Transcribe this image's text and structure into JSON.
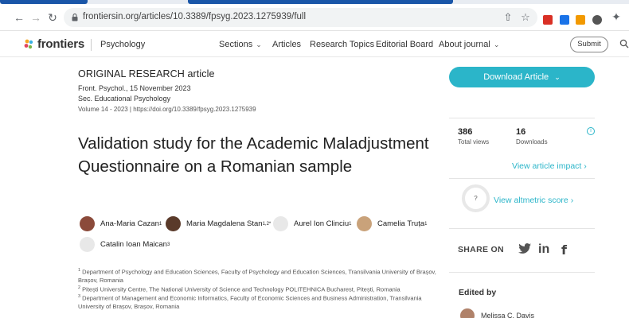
{
  "browser": {
    "url": "frontiersin.org/articles/10.3389/fpsyg.2023.1275939/full",
    "nav_icons": [
      "back-arrow-icon",
      "forward-arrow-icon",
      "reload-icon"
    ],
    "extension_colors": [
      "#d93025",
      "#1a73e8",
      "#f29900",
      "#555555"
    ]
  },
  "site": {
    "logo": "frontiers",
    "journal": "Psychology",
    "nav": [
      {
        "label": "Sections",
        "caret": true
      },
      {
        "label": "Articles",
        "caret": false
      },
      {
        "label": "Research Topics",
        "caret": false
      },
      {
        "label": "Editorial Board",
        "caret": false
      },
      {
        "label": "About journal",
        "caret": true
      }
    ],
    "submit": "Submit"
  },
  "article": {
    "type": "ORIGINAL RESEARCH article",
    "journal_date": "Front. Psychol., 15 November 2023",
    "section": "Sec. Educational Psychology",
    "volume_doi": "Volume 14 - 2023 | https://doi.org/10.3389/fpsyg.2023.1275939",
    "title": "Validation study for the Academic Maladjustment Questionnaire on a Romanian sample",
    "authors": [
      {
        "name": "Ana-Maria Cazan",
        "sup": "1"
      },
      {
        "name": "Maria Magdalena Stan",
        "sup": "1,2*"
      },
      {
        "name": "Aurel Ion Clinciu",
        "sup": "1"
      },
      {
        "name": "Camelia Truța",
        "sup": "1"
      },
      {
        "name": "Catalin Ioan Maican",
        "sup": "3"
      }
    ],
    "affiliations": [
      {
        "sup": "1",
        "text": " Department of Psychology and Education Sciences, Faculty of Psychology and Education Sciences, Transilvania University of Brașov, Brașov, Romania"
      },
      {
        "sup": "2",
        "text": " Pitești University Centre, The National University of Science and Technology POLITEHNICA Bucharest, Pitești, Romania"
      },
      {
        "sup": "3",
        "text": " Department of Management and Economic Informatics, Faculty of Economic Sciences and Business Administration, Transilvania University of Brașov, Brașov, Romania"
      }
    ]
  },
  "sidebar": {
    "download": "Download Article",
    "stats": [
      {
        "value": "386",
        "label": "Total views"
      },
      {
        "value": "16",
        "label": "Downloads"
      }
    ],
    "impact_link": "View article impact",
    "altmetric_badge": "?",
    "altmetric_link": "View altmetric score",
    "share_label": "SHARE ON",
    "social": [
      "twitter-icon",
      "linkedin-icon",
      "facebook-icon"
    ],
    "edited_by": "Edited by",
    "editor": "Melissa C. Davis"
  },
  "colors": {
    "accent": "#2bb5c9",
    "chrome_blue": "#1a56a8"
  }
}
